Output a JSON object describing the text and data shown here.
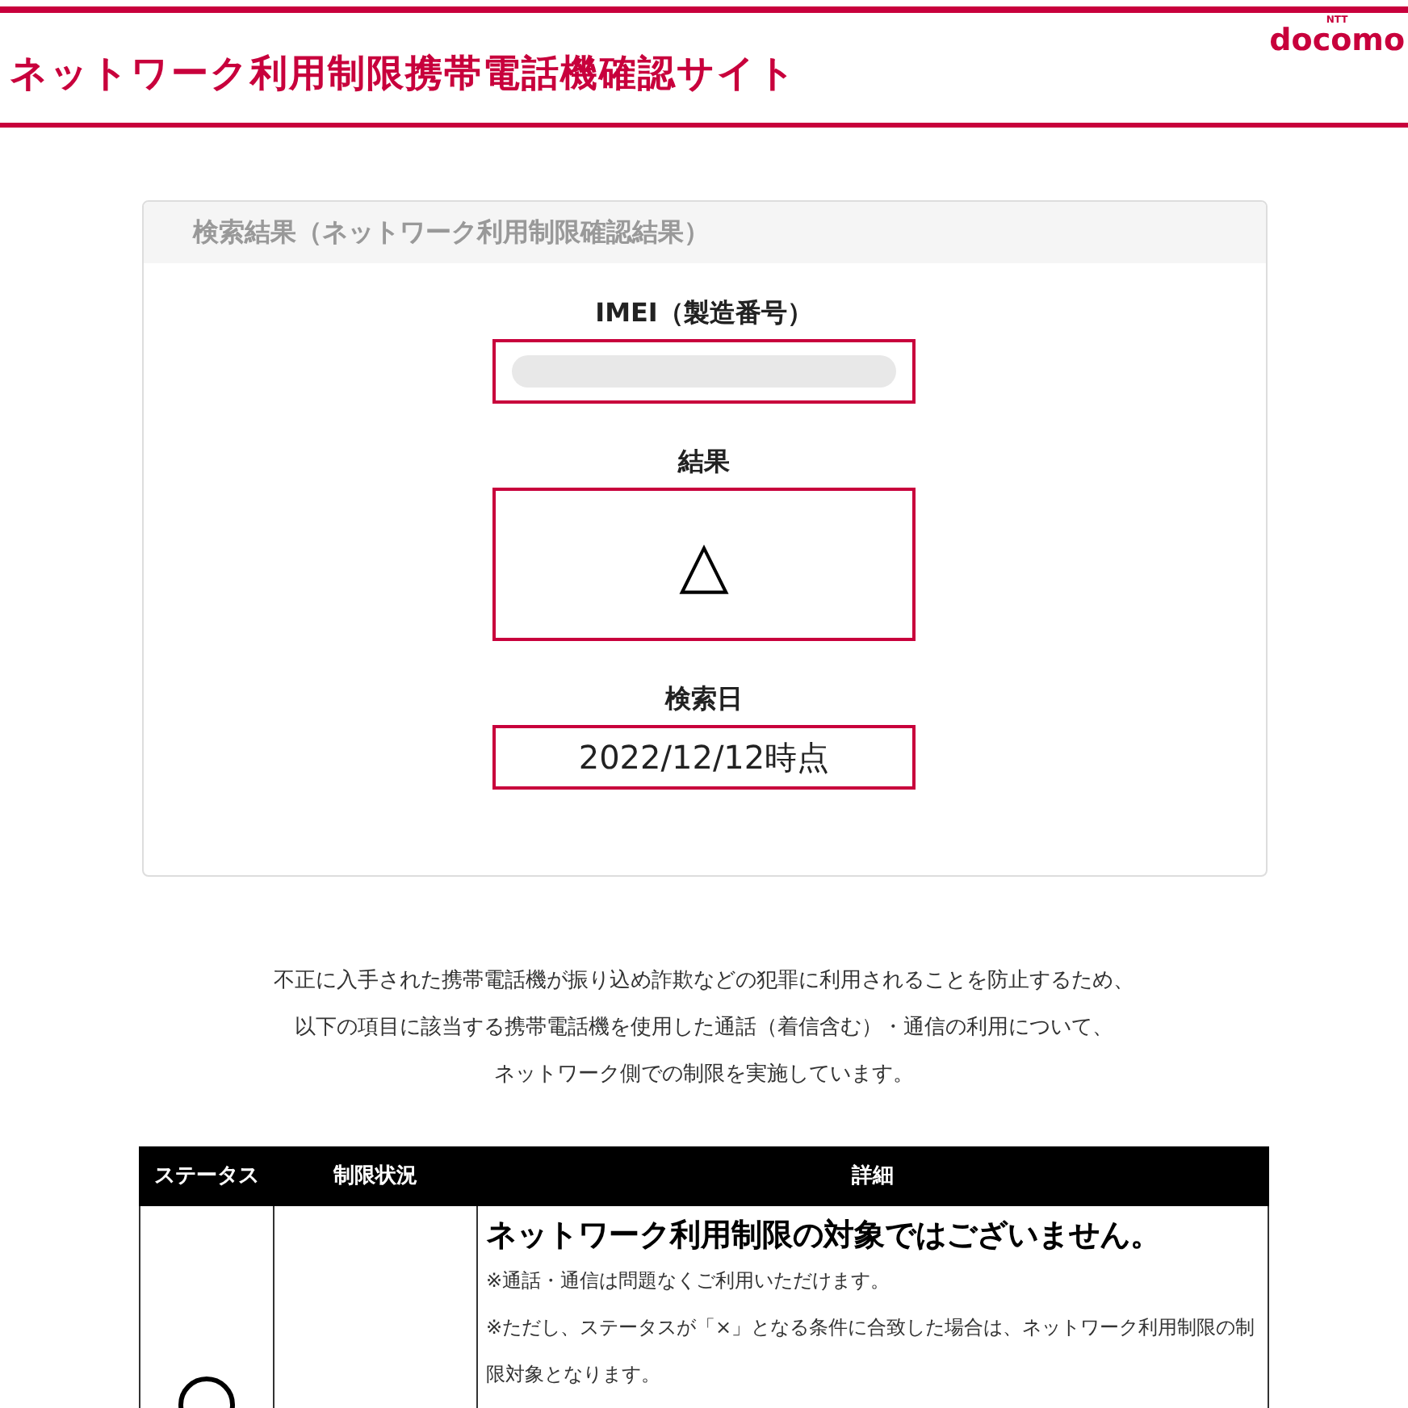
{
  "header": {
    "title": "ネットワーク利用制限携帯電話機確認サイト",
    "logo": {
      "small": "NTT",
      "name": "docomo"
    }
  },
  "result_card": {
    "title": "検索結果（ネットワーク利用制限確認結果）",
    "fields": [
      {
        "label": "IMEI（製造番号）",
        "kind": "redacted"
      },
      {
        "label": "結果",
        "kind": "symbol",
        "value": "△"
      },
      {
        "label": "検索日",
        "kind": "text",
        "value": "2022/12/12時点"
      }
    ]
  },
  "notice": [
    "不正に入手された携帯電話機が振り込め詐欺などの犯罪に利用されることを防止するため、",
    "以下の項目に該当する携帯電話機を使用した通話（着信含む）・通信の利用について、",
    "ネットワーク側での制限を実施しています。"
  ],
  "table": {
    "columns": [
      "ステータス",
      "制限状況",
      "詳細"
    ],
    "rows": [
      {
        "kind": "ok",
        "detail_title": "ネットワーク利用制限の対象ではございません。",
        "notes": [
          "※通話・通信は問題なくご利用いただけます。",
          "※ただし、ステータスが「×」となる条件に合致した場合は、ネットワーク利用制限の制限対象となります。"
        ]
      }
    ]
  }
}
